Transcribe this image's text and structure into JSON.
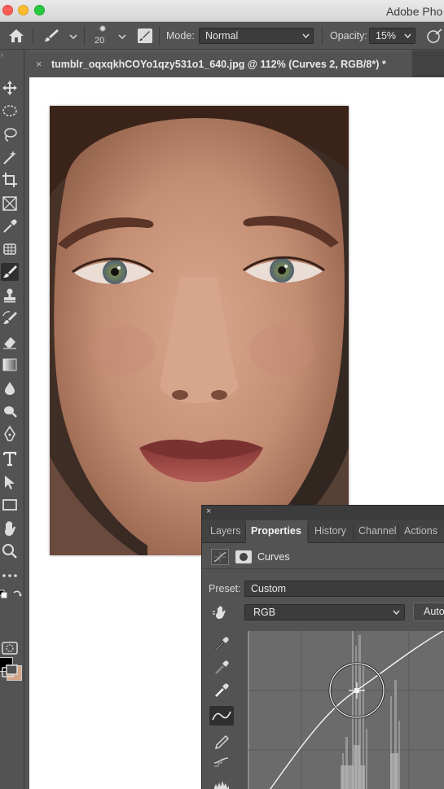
{
  "app": {
    "title": "Adobe Pho"
  },
  "options_bar": {
    "brush_size": "20",
    "mode_label": "Mode:",
    "mode_value": "Normal",
    "opacity_label": "Opacity:",
    "opacity_value": "15%"
  },
  "document": {
    "tab_close": "×",
    "tab_title": "tumblr_oqxqkhCOYo1qzy531o1_640.jpg @ 112% (Curves 2, RGB/8*) *"
  },
  "toolbar": {
    "tools": [
      "move-icon",
      "marquee-icon",
      "lasso-icon",
      "magic-wand-icon",
      "crop-icon",
      "frame-icon",
      "eyedropper-icon",
      "patch-icon",
      "brush-icon",
      "stamp-icon",
      "history-brush-icon",
      "eraser-icon",
      "gradient-icon",
      "blur-icon",
      "dodge-icon",
      "pen-icon",
      "type-icon",
      "path-select-icon",
      "rectangle-icon",
      "hand-icon",
      "zoom-icon",
      "more-icon"
    ],
    "active_tool": "brush-icon",
    "foreground_color": "#000000",
    "background_color": "#d5a588"
  },
  "properties_panel": {
    "close": "×",
    "tabs": [
      "Layers",
      "Properties",
      "History",
      "Channel",
      "Actions"
    ],
    "active_tab": "Properties",
    "adjustment_label": "Curves",
    "preset_label": "Preset:",
    "preset_value": "Custom",
    "channel_value": "RGB",
    "auto_label": "Auto",
    "graph_tools": [
      "black-point-eyedropper-icon",
      "gray-point-eyedropper-icon",
      "white-point-eyedropper-icon",
      "curve-points-icon",
      "pencil-icon",
      "smooth-icon",
      "histogram-icon"
    ],
    "active_graph_tool": "curve-points-icon"
  },
  "colors": {
    "panel_bg": "#535353",
    "canvas_bg": "#ffffff",
    "dark_field": "#3c3c3c"
  }
}
